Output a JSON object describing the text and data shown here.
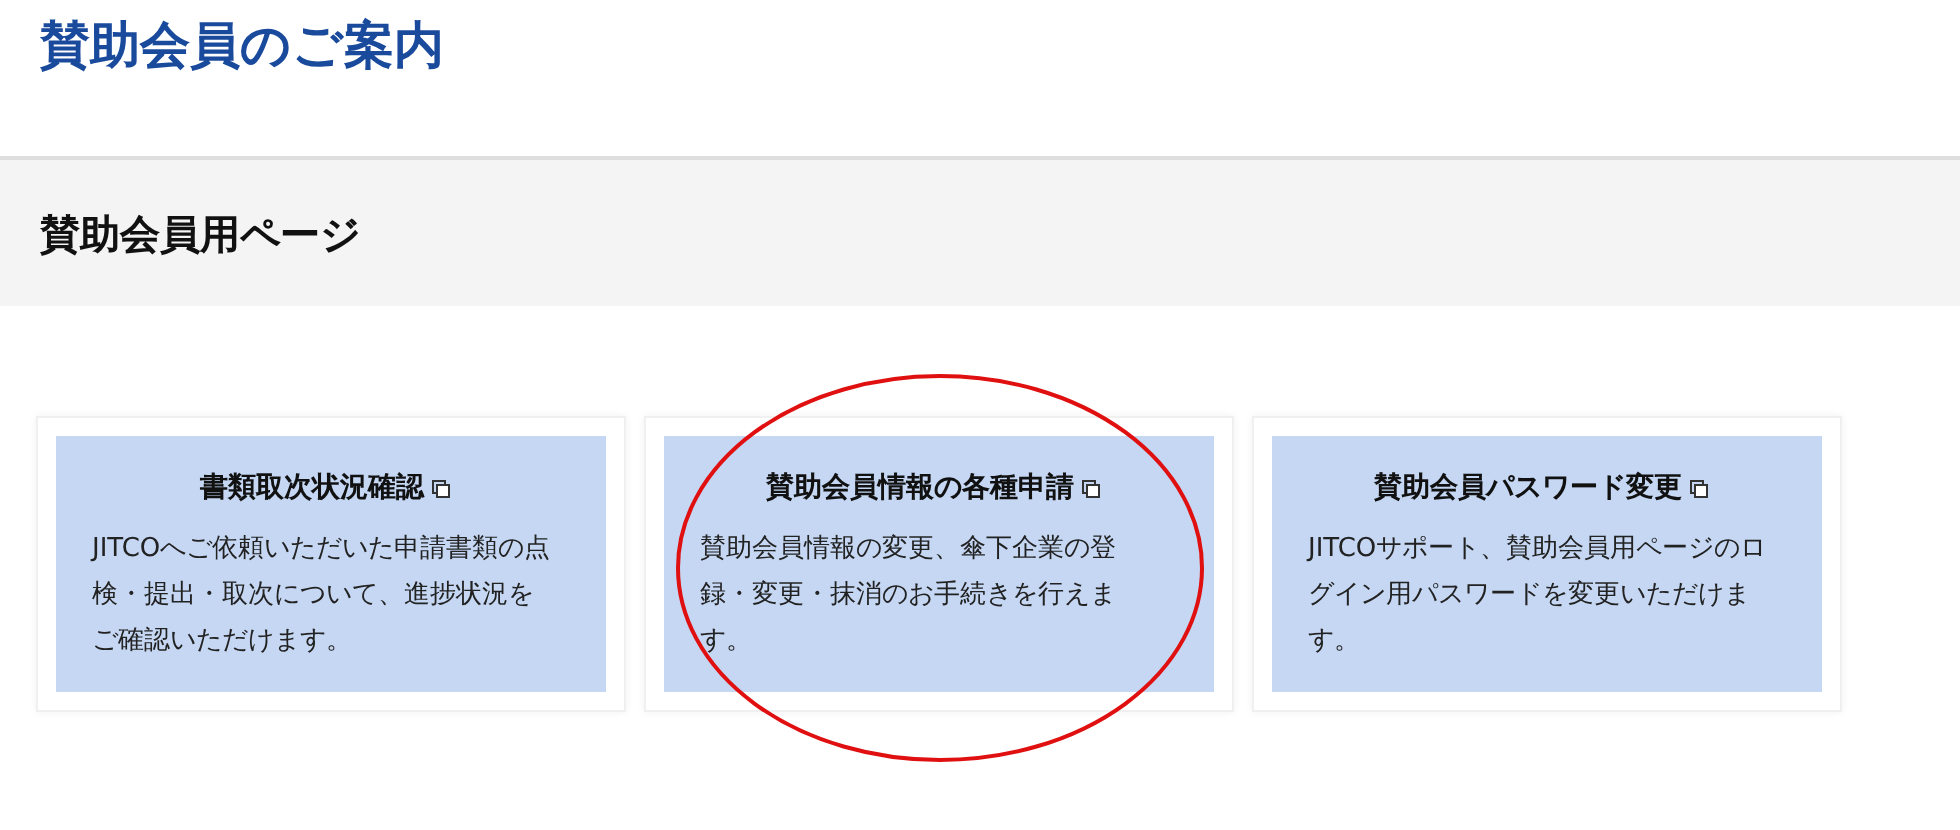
{
  "page_title": "賛助会員のご案内",
  "section_title": "賛助会員用ページ",
  "cards": [
    {
      "title": "書類取次状況確認",
      "description": "JITCOへご依頼いただいた申請書類の点検・提出・取次について、進捗状況をご確認いただけます。",
      "circled": false
    },
    {
      "title": "賛助会員情報の各種申請",
      "description": "賛助会員情報の変更、傘下企業の登録・変更・抹消のお手続きを行えます。",
      "circled": true
    },
    {
      "title": "賛助会員パスワード変更",
      "description": "JITCOサポート、賛助会員用ページのログイン用パスワードを変更いただけます。",
      "circled": false
    }
  ]
}
